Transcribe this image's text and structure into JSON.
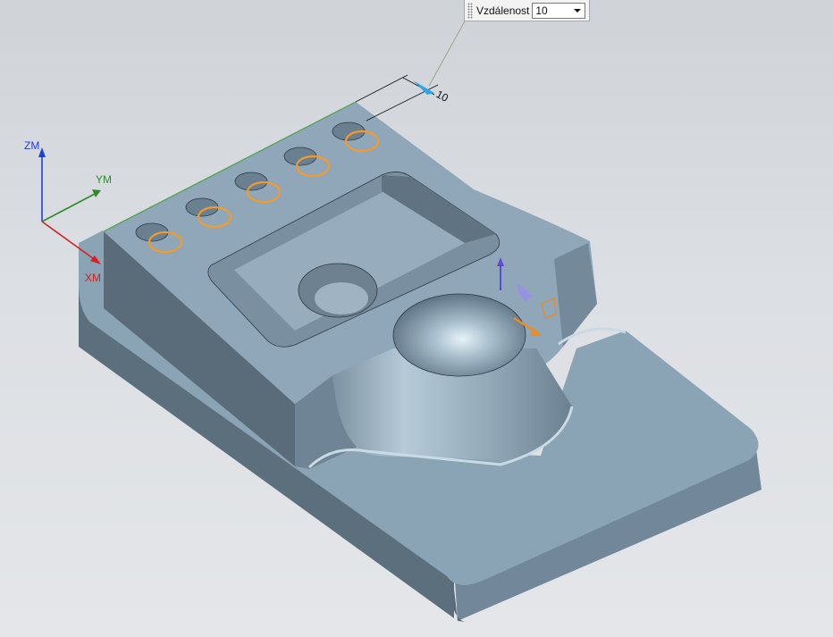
{
  "hud": {
    "label": "Vzdálenost",
    "value": "10"
  },
  "dimension": {
    "text": "10"
  },
  "triad": {
    "z_label": "ZM",
    "y_label": "YM",
    "x_label": "XM",
    "z_color": "#1f3fd6",
    "y_color": "#2e8b2e",
    "x_color": "#d62020"
  },
  "colors": {
    "top_face": "#8ea6b8",
    "side_face": "#5e7180",
    "front_face": "#6f8595",
    "highlight": "#f39a2a",
    "dimension": "#2da7e6"
  }
}
